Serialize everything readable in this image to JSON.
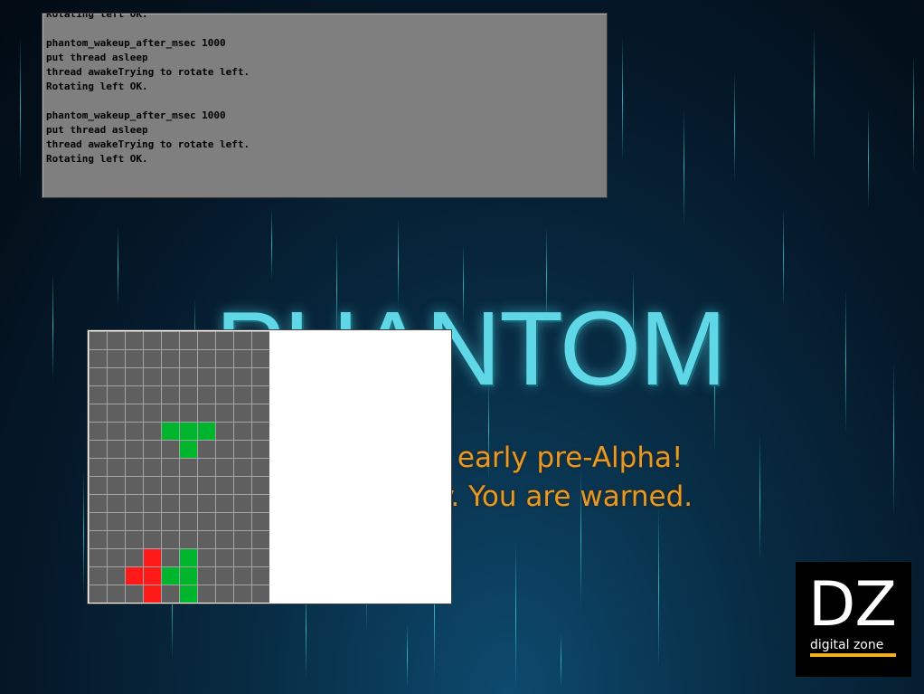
{
  "console": {
    "lines": [
      "Rotating left OK.",
      "",
      "phantom_wakeup_after_msec 1000",
      "put thread asleep",
      "thread awakeTrying to rotate left.",
      "Rotating left OK.",
      "",
      "phantom_wakeup_after_msec 1000",
      "put thread asleep",
      "thread awakeTrying to rotate left.",
      "Rotating left OK."
    ]
  },
  "splash": {
    "title": "PHANTOM",
    "warning_line_1": "This build is early pre-Alpha!",
    "warning_line_2": "It is buggy. You are warned."
  },
  "game": {
    "columns": 10,
    "rows": 15,
    "cells": [
      {
        "col": 4,
        "row": 5,
        "color": "#00b52e"
      },
      {
        "col": 5,
        "row": 5,
        "color": "#00b52e"
      },
      {
        "col": 6,
        "row": 5,
        "color": "#00b52e"
      },
      {
        "col": 5,
        "row": 6,
        "color": "#00b52e"
      },
      {
        "col": 3,
        "row": 12,
        "color": "#ff1a1a"
      },
      {
        "col": 2,
        "row": 13,
        "color": "#ff1a1a"
      },
      {
        "col": 3,
        "row": 13,
        "color": "#ff1a1a"
      },
      {
        "col": 3,
        "row": 14,
        "color": "#ff1a1a"
      },
      {
        "col": 5,
        "row": 12,
        "color": "#00b52e"
      },
      {
        "col": 4,
        "row": 13,
        "color": "#00b52e"
      },
      {
        "col": 5,
        "row": 13,
        "color": "#00b52e"
      },
      {
        "col": 5,
        "row": 14,
        "color": "#00b52e"
      }
    ]
  },
  "logo": {
    "mark": "DZ",
    "name": "digital zone",
    "accent_color": "#f2b01e"
  }
}
